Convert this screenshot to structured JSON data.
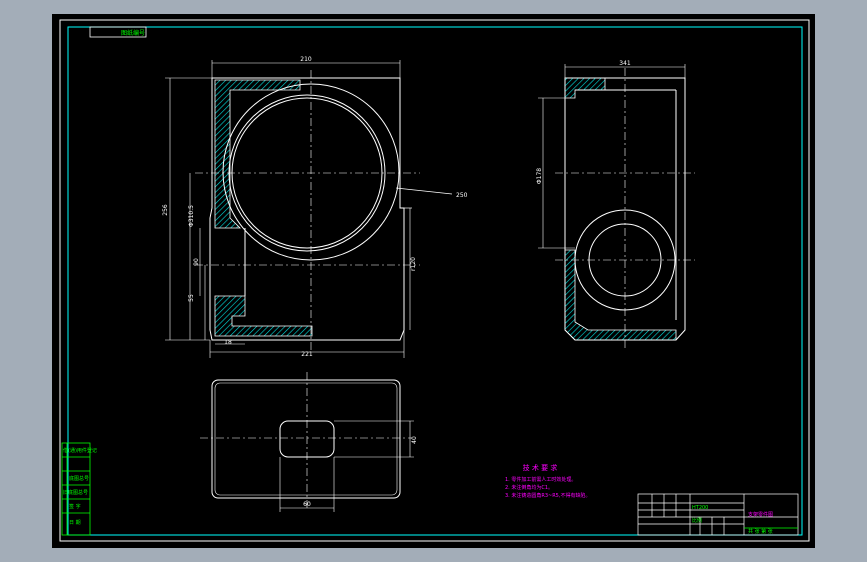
{
  "drawing": {
    "title_tab": "图纸编号",
    "dimensions": {
      "top_width": "210",
      "radius_note": "250",
      "overall_height": "256",
      "bore_dim": "Φ310.5",
      "sub_height_a": "90",
      "sub_height_b": "55",
      "radius_r": "r120",
      "bottom_small": "18",
      "bottom_width": "221",
      "side_width": "341",
      "side_bore": "Φ178",
      "plan_slot_width": "60",
      "plan_slot_height": "40"
    },
    "tech_requirements": {
      "title": "技 术 要 求",
      "items": [
        "1. 零件加工前需人工时效处理。",
        "2. 未注倒角均为C1。",
        "3. 未注铸造圆角R3~R5,不得有缺陷。"
      ]
    },
    "left_table": {
      "rows": [
        "借(通)用件登记",
        "旧底图总号",
        "底图总号",
        "签 字",
        "日 期"
      ]
    },
    "title_block": {
      "part_name": "支架零件图",
      "material": "HT200",
      "scale_label": "比例",
      "sheet_label": "共 张 第 张"
    }
  },
  "colors": {
    "paper": "#000000",
    "frame": "#ffffff",
    "accent": "#00ffff",
    "tech_text": "#ff00ff",
    "background": "#a3adb8",
    "hatch": "#00e0e0"
  }
}
